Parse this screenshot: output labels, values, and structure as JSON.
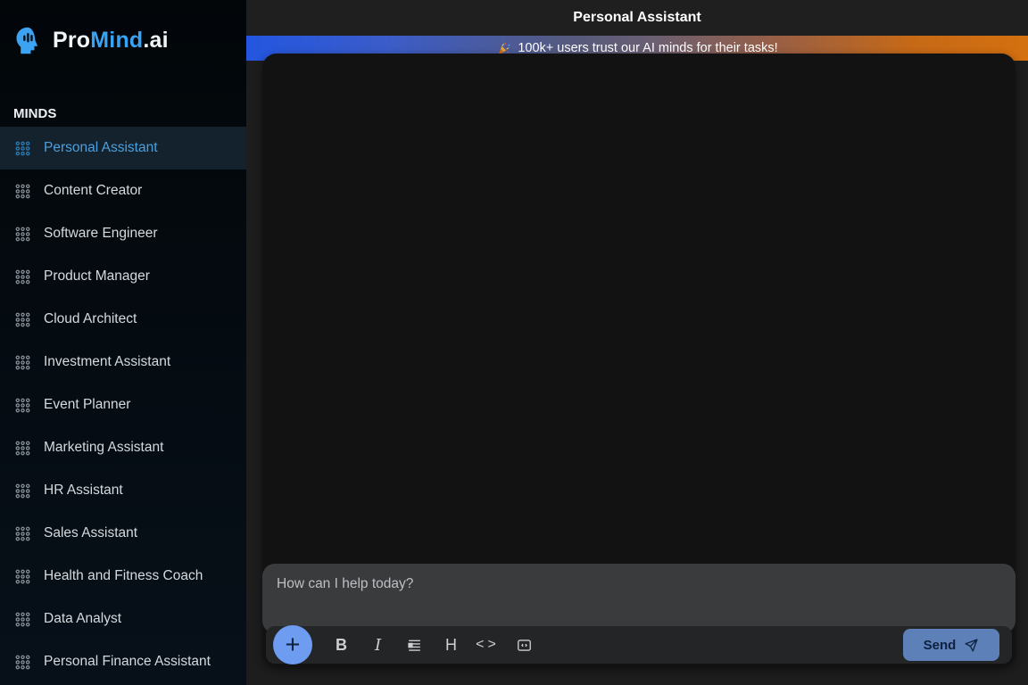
{
  "brand": {
    "prefix": "Pro",
    "accent": "Mind",
    "suffix": ".ai"
  },
  "sidebar": {
    "section_label": "MINDS",
    "items": [
      {
        "label": "Personal Assistant",
        "active": true
      },
      {
        "label": "Content Creator",
        "active": false
      },
      {
        "label": "Software Engineer",
        "active": false
      },
      {
        "label": "Product Manager",
        "active": false
      },
      {
        "label": "Cloud Architect",
        "active": false
      },
      {
        "label": "Investment Assistant",
        "active": false
      },
      {
        "label": "Event Planner",
        "active": false
      },
      {
        "label": "Marketing Assistant",
        "active": false
      },
      {
        "label": "HR Assistant",
        "active": false
      },
      {
        "label": "Sales Assistant",
        "active": false
      },
      {
        "label": "Health and Fitness Coach",
        "active": false
      },
      {
        "label": "Data Analyst",
        "active": false
      },
      {
        "label": "Personal Finance Assistant",
        "active": false
      }
    ]
  },
  "header": {
    "title": "Personal Assistant"
  },
  "banner": {
    "emoji": "🎉",
    "text": "100k+ users trust our AI minds for their tasks!"
  },
  "composer": {
    "placeholder": "How can I help today?",
    "toolbar": {
      "add": "+",
      "bold": "B",
      "italic": "I",
      "heading": "H",
      "inline_code": "<>",
      "send": "Send"
    }
  },
  "colors": {
    "accent_blue": "#37a3f5",
    "active_item_text": "#4ba0de",
    "active_item_bg": "#14222d",
    "banner_gradient_left": "#2356e0",
    "banner_gradient_right": "#d4700f",
    "add_button": "#6d9cf1",
    "send_button": "#5c80b7",
    "sidebar_bg": "#071019",
    "card_bg": "#121212",
    "main_bg": "#1d1d1d"
  }
}
